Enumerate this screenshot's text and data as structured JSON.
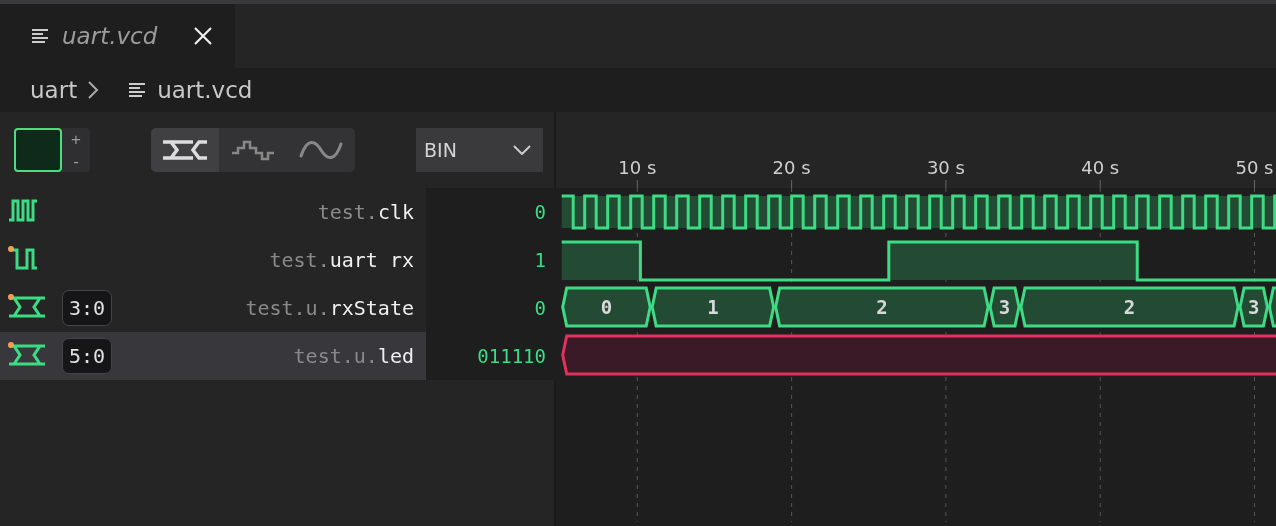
{
  "tab": {
    "title": "uart.vcd",
    "selected": true
  },
  "breadcrumb": [
    "uart",
    "uart.vcd"
  ],
  "toolbar": {
    "zoom_in": "+",
    "zoom_out": "-",
    "display_modes": [
      {
        "kind": "bus",
        "selected": true
      },
      {
        "kind": "step",
        "selected": false
      },
      {
        "kind": "analog",
        "selected": false
      }
    ],
    "format": "BIN"
  },
  "ruler": {
    "ticks": [
      "10 s",
      "20 s",
      "30 s",
      "40 s",
      "50 s"
    ]
  },
  "signals": [
    {
      "kind": "clock",
      "scope": "test.",
      "name": "clk",
      "value": "0",
      "marked": false,
      "selected": false,
      "color": "#3ddc84"
    },
    {
      "kind": "bit",
      "scope": "test.",
      "name": "uart rx",
      "value": "1",
      "marked": true,
      "selected": false,
      "color": "#3ddc84"
    },
    {
      "kind": "bus",
      "width": "3:0",
      "scope": "test.u.",
      "name": "rxState",
      "value": "0",
      "marked": true,
      "selected": false,
      "color": "#3ddc84",
      "segments": [
        "0",
        "1",
        "2",
        "3",
        "2",
        "3"
      ]
    },
    {
      "kind": "bus",
      "width": "5:0",
      "scope": "test.u.",
      "name": "led",
      "value": "011110",
      "marked": true,
      "selected": true,
      "color": "#e5305f"
    }
  ]
}
